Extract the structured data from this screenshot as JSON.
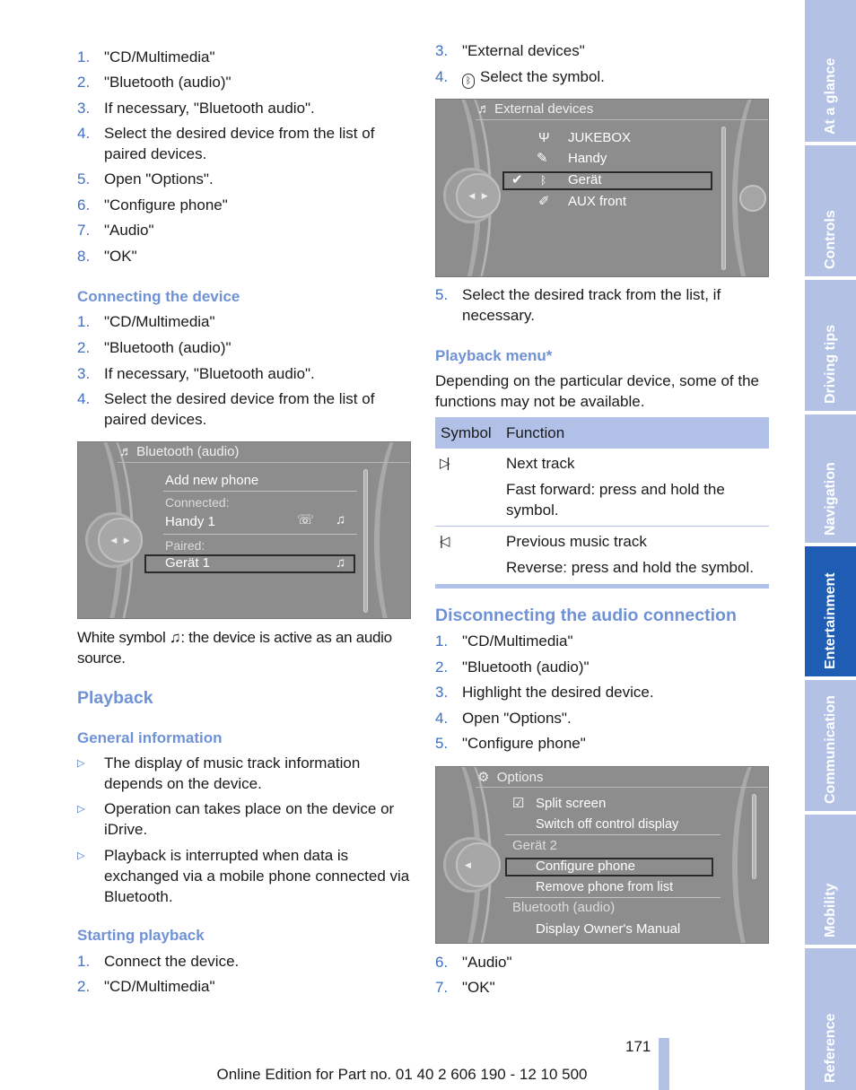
{
  "left": {
    "list1": [
      {
        "n": "1.",
        "t": "\"CD/Multimedia\""
      },
      {
        "n": "2.",
        "t": "\"Bluetooth (audio)\""
      },
      {
        "n": "3.",
        "t": "If necessary, \"Bluetooth audio\"."
      },
      {
        "n": "4.",
        "t": "Select the desired device from the list of paired devices."
      },
      {
        "n": "5.",
        "t": "Open \"Options\"."
      },
      {
        "n": "6.",
        "t": "\"Configure phone\""
      },
      {
        "n": "7.",
        "t": "\"Audio\""
      },
      {
        "n": "8.",
        "t": "\"OK\""
      }
    ],
    "connecting_heading": "Connecting the device",
    "list2": [
      {
        "n": "1.",
        "t": "\"CD/Multimedia\""
      },
      {
        "n": "2.",
        "t": "\"Bluetooth (audio)\""
      },
      {
        "n": "3.",
        "t": "If necessary, \"Bluetooth audio\"."
      },
      {
        "n": "4.",
        "t": "Select the desired device from the list of paired devices."
      }
    ],
    "screen1": {
      "title": "Bluetooth (audio)",
      "add": "Add new phone",
      "connected": "Connected:",
      "handy": "Handy 1",
      "paired": "Paired:",
      "geraet": "Gerät 1"
    },
    "white_symbol_pre": "White symbol ",
    "white_symbol_icon": "♫",
    "white_symbol_post": ": the device is active as an audio source.",
    "playback_heading": "Playback",
    "general_heading": "General information",
    "bullets": [
      "The display of music track information depends on the device.",
      "Operation can takes place on the device or iDrive.",
      "Playback is interrupted when data is exchanged via a mobile phone connected via Bluetooth."
    ],
    "starting_heading": "Starting playback",
    "list3": [
      {
        "n": "1.",
        "t": "Connect the device."
      },
      {
        "n": "2.",
        "t": "\"CD/Multimedia\""
      }
    ]
  },
  "right": {
    "list1": [
      {
        "n": "3.",
        "t": "\"External devices\""
      },
      {
        "n": "4.",
        "t": "Select the symbol."
      }
    ],
    "screen2": {
      "title": "External devices",
      "items": [
        "JUKEBOX",
        "Handy",
        "Gerät",
        "AUX front"
      ]
    },
    "list2": [
      {
        "n": "5.",
        "t": "Select the desired track from the list, if necessary."
      }
    ],
    "playback_menu_heading": "Playback menu*",
    "playback_menu_text": "Depending on the particular device, some of the functions may not be available.",
    "table": {
      "headers": [
        "Symbol",
        "Function"
      ],
      "rows": [
        {
          "symbol": "▷|",
          "lines": [
            "Next track",
            "Fast forward: press and hold the symbol."
          ]
        },
        {
          "symbol": "|◁",
          "lines": [
            "Previous music track",
            "Reverse: press and hold the symbol."
          ]
        }
      ]
    },
    "disconnect_heading": "Disconnecting the audio connection",
    "list3": [
      {
        "n": "1.",
        "t": "\"CD/Multimedia\""
      },
      {
        "n": "2.",
        "t": "\"Bluetooth (audio)\""
      },
      {
        "n": "3.",
        "t": "Highlight the desired device."
      },
      {
        "n": "4.",
        "t": "Open \"Options\"."
      },
      {
        "n": "5.",
        "t": "\"Configure phone\""
      }
    ],
    "screen3": {
      "title": "Options",
      "items": [
        "Split screen",
        "Switch off control display",
        "Gerät 2",
        "Configure phone",
        "Remove phone from list",
        "Bluetooth (audio)",
        "Display Owner's Manual"
      ]
    },
    "list4": [
      {
        "n": "6.",
        "t": "\"Audio\""
      },
      {
        "n": "7.",
        "t": "\"OK\""
      }
    ]
  },
  "page_number": "171",
  "footer": "Online Edition for Part no. 01 40 2 606 190 - 12 10 500",
  "tabs": [
    {
      "label": "At a glance"
    },
    {
      "label": "Controls"
    },
    {
      "label": "Driving tips"
    },
    {
      "label": "Navigation"
    },
    {
      "label": "Entertainment",
      "active": true
    },
    {
      "label": "Communication"
    },
    {
      "label": "Mobility"
    },
    {
      "label": "Reference"
    }
  ],
  "colors": {
    "accent": "#3f6fc0",
    "heading": "#6f92d6",
    "tab": "#b3c1e5",
    "tab_active": "#1f5db4",
    "table_header": "#b0c0e6"
  }
}
